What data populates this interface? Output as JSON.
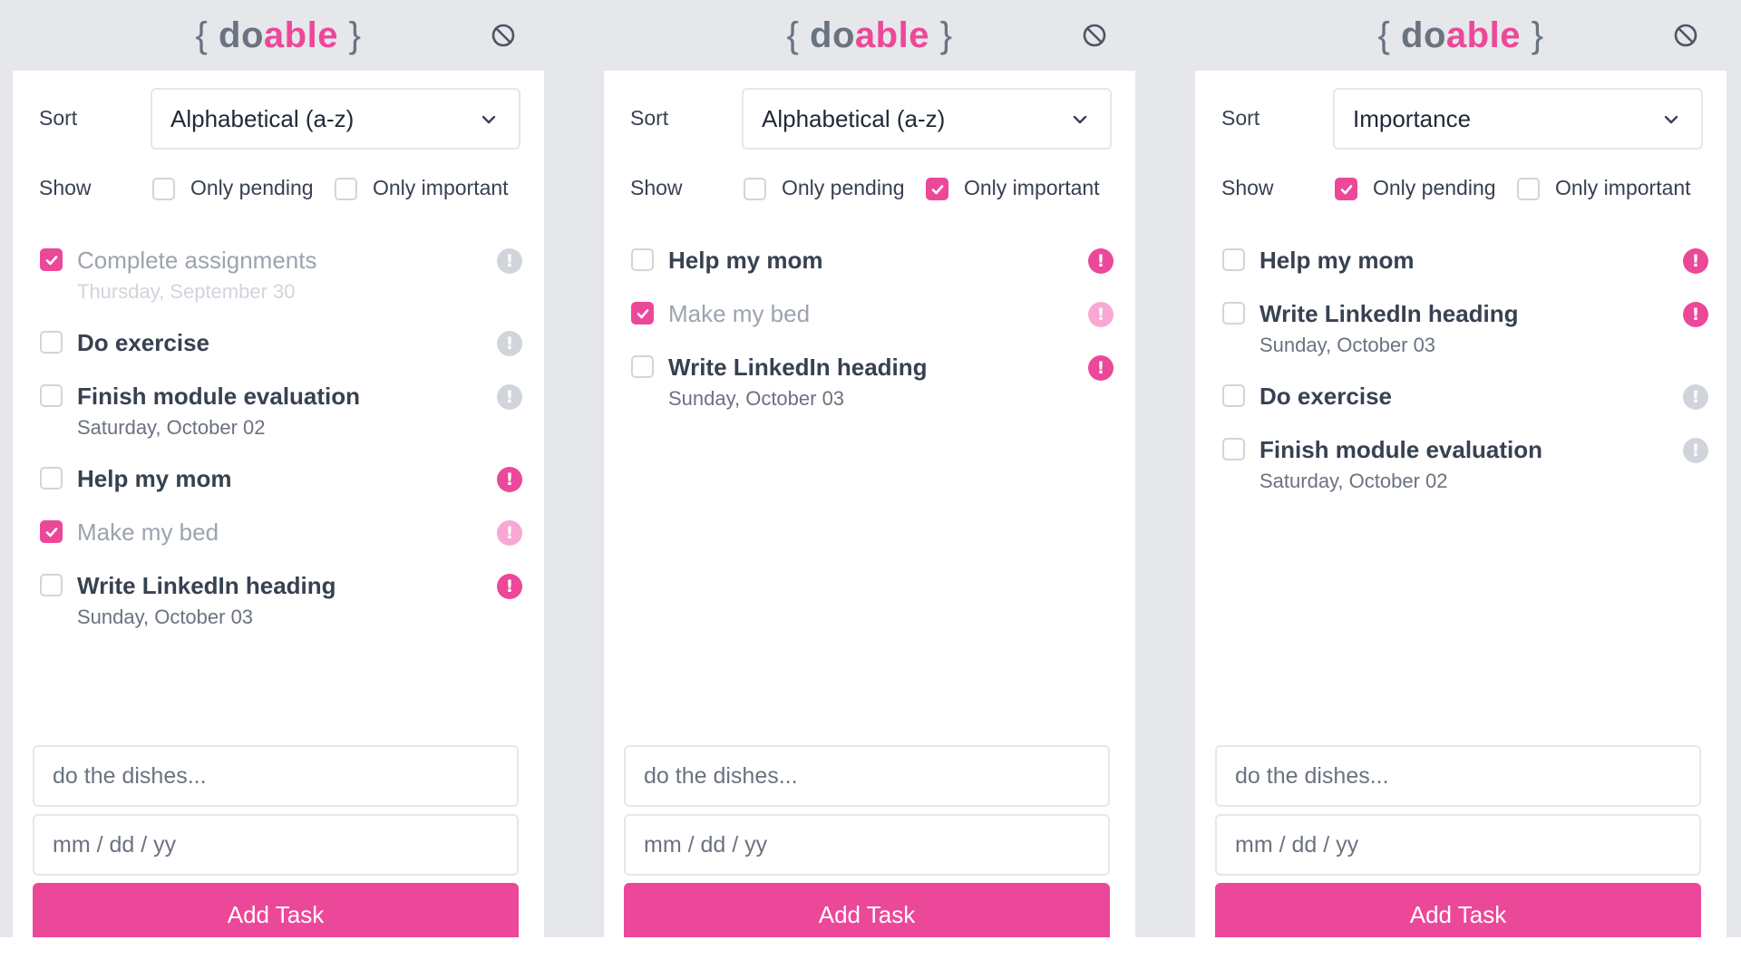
{
  "colors": {
    "accent": "#ec4899",
    "accent_pale": "#f9a8d4",
    "header_bg": "#e5e7eb",
    "muted": "#9ca3af"
  },
  "panels": [
    {
      "logo": {
        "open": "{ ",
        "do": "do",
        "able": "able",
        "close": " }"
      },
      "sort_label": "Sort",
      "sort_value": "Alphabetical (a-z)",
      "show_label": "Show",
      "filters": [
        {
          "label": "Only pending",
          "checked": false
        },
        {
          "label": "Only important",
          "checked": false
        }
      ],
      "tasks": [
        {
          "title": "Complete assignments",
          "date": "Thursday, September 30",
          "done": true,
          "important": false
        },
        {
          "title": "Do exercise",
          "date": "",
          "done": false,
          "important": false
        },
        {
          "title": "Finish module evaluation",
          "date": "Saturday, October 02",
          "done": false,
          "important": false
        },
        {
          "title": "Help my mom",
          "date": "",
          "done": false,
          "important": true
        },
        {
          "title": "Make my bed",
          "date": "",
          "done": true,
          "important": true
        },
        {
          "title": "Write LinkedIn heading",
          "date": "Sunday, October 03",
          "done": false,
          "important": true
        }
      ],
      "task_placeholder": "do the dishes...",
      "date_placeholder": "mm / dd / yy",
      "add_label": "Add Task"
    },
    {
      "logo": {
        "open": "{ ",
        "do": "do",
        "able": "able",
        "close": " }"
      },
      "sort_label": "Sort",
      "sort_value": "Alphabetical (a-z)",
      "show_label": "Show",
      "filters": [
        {
          "label": "Only pending",
          "checked": false
        },
        {
          "label": "Only important",
          "checked": true
        }
      ],
      "tasks": [
        {
          "title": "Help my mom",
          "date": "",
          "done": false,
          "important": true
        },
        {
          "title": "Make my bed",
          "date": "",
          "done": true,
          "important": true
        },
        {
          "title": "Write LinkedIn heading",
          "date": "Sunday, October 03",
          "done": false,
          "important": true
        }
      ],
      "task_placeholder": "do the dishes...",
      "date_placeholder": "mm / dd / yy",
      "add_label": "Add Task"
    },
    {
      "logo": {
        "open": "{ ",
        "do": "do",
        "able": "able",
        "close": " }"
      },
      "sort_label": "Sort",
      "sort_value": "Importance",
      "show_label": "Show",
      "filters": [
        {
          "label": "Only pending",
          "checked": true
        },
        {
          "label": "Only important",
          "checked": false
        }
      ],
      "tasks": [
        {
          "title": "Help my mom",
          "date": "",
          "done": false,
          "important": true
        },
        {
          "title": "Write LinkedIn heading",
          "date": "Sunday, October 03",
          "done": false,
          "important": true
        },
        {
          "title": "Do exercise",
          "date": "",
          "done": false,
          "important": false
        },
        {
          "title": "Finish module evaluation",
          "date": "Saturday, October 02",
          "done": false,
          "important": false
        }
      ],
      "task_placeholder": "do the dishes...",
      "date_placeholder": "mm / dd / yy",
      "add_label": "Add Task"
    }
  ]
}
